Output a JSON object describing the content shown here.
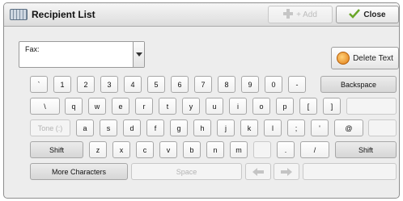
{
  "header": {
    "title": "Recipient List",
    "add_label": "+ Add",
    "close_label": "Close"
  },
  "fax": {
    "label": "Fax:"
  },
  "actions": {
    "delete_label": "Delete Text"
  },
  "keyboard": {
    "row1": [
      "`",
      "1",
      "2",
      "3",
      "4",
      "5",
      "6",
      "7",
      "8",
      "9",
      "0",
      "-"
    ],
    "row1_end": "Backspace",
    "row2": [
      "\\",
      "q",
      "w",
      "e",
      "r",
      "t",
      "y",
      "u",
      "i",
      "o",
      "p",
      "[",
      "]"
    ],
    "row3_start": "Tone (:)",
    "row3": [
      "a",
      "s",
      "d",
      "f",
      "g",
      "h",
      "j",
      "k",
      "l",
      ";",
      "'",
      "@"
    ],
    "row4_start": "Shift",
    "row4": [
      "z",
      "x",
      "c",
      "v",
      "b",
      "n",
      "m",
      "",
      ".",
      "/"
    ],
    "row4_end": "Shift",
    "row5_start": "More Characters",
    "row5_space": "Space"
  },
  "colors": {
    "accent": "#e07a12",
    "check": "#6aa629"
  }
}
